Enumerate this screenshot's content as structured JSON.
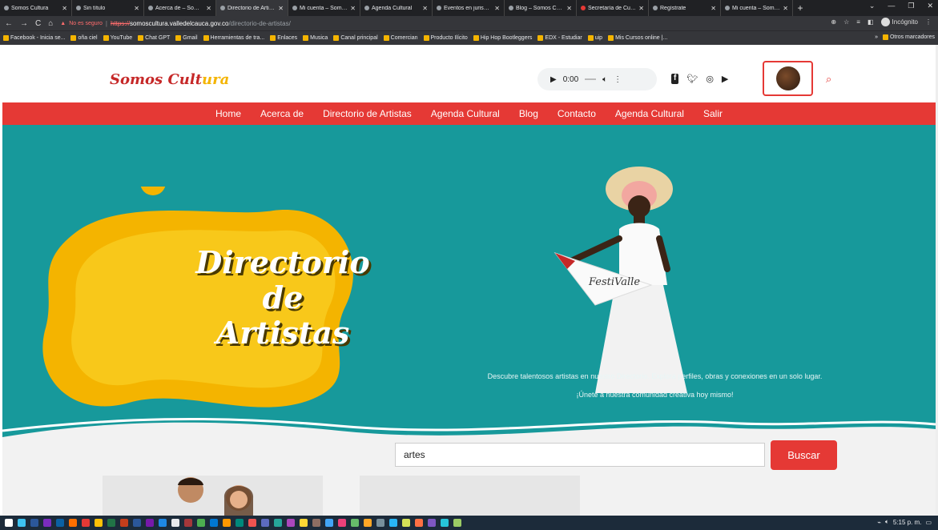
{
  "browser": {
    "tabs": [
      {
        "title": "Somos Cultura",
        "active": false
      },
      {
        "title": "Sin título",
        "active": false
      },
      {
        "title": "Acerca de – Somos Cultura",
        "active": false
      },
      {
        "title": "Directorio de Artistas",
        "active": true
      },
      {
        "title": "Mi cuenta – Somos Cultura",
        "active": false
      },
      {
        "title": "Agenda Cultural",
        "active": false
      },
      {
        "title": "Eventos en jurisdicción",
        "active": false
      },
      {
        "title": "Blog – Somos Cultura",
        "active": false
      },
      {
        "title": "Secretaría de Cultura",
        "active": false
      },
      {
        "title": "Regístrate",
        "active": false
      },
      {
        "title": "Mi cuenta – Somos Cultura",
        "active": false
      }
    ],
    "new_tab": "+",
    "security_warning": "No es seguro",
    "url_scheme": "https://",
    "url_host": "somoscultura.valledelcauca.gov.co",
    "url_path": "/directorio-de-artistas/",
    "incognito_label": "Incógnito",
    "bookmarks": [
      "Facebook - Inicia se...",
      "oña ciel",
      "YouTube",
      "Chat GPT",
      "Gmail",
      "Herramientas de tra...",
      "Enlaces",
      "Musica",
      "Canal principal",
      "Comercian",
      "Producto Ilícito",
      "Hip Hop Bootleggers",
      "EDX - Estudiar",
      "uip",
      "Mis Cursos online |..."
    ],
    "other_bookmarks": "Otros marcadores"
  },
  "site": {
    "logo_main": "Somos Cult",
    "logo_highlight": "ura",
    "player_time": "0:00",
    "nav": [
      "Home",
      "Acerca de",
      "Directorio de Artistas",
      "Agenda Cultural",
      "Blog",
      "Contacto",
      "Agenda Cultural",
      "Salir"
    ],
    "hero_title_line1": "Directorio de",
    "hero_title_line2": "Artistas",
    "hero_tagline": "Descubre talentosos artistas en nuestro Directorio. Explora perfiles, obras y conexiones en un solo lugar. ¡Únete a nuestra comunidad creativa hoy mismo!",
    "flag_text": "FestiValle",
    "search_value": "artes",
    "search_button": "Buscar"
  },
  "taskbar": {
    "time": "5:15 p. m."
  },
  "colors": {
    "brand_red": "#e53935",
    "hero_teal": "#17999b",
    "blob_yellow": "#f4b400"
  }
}
